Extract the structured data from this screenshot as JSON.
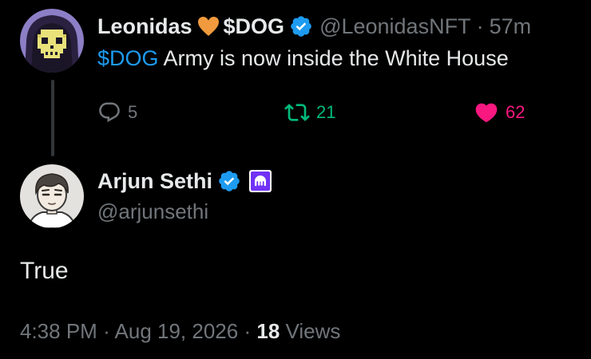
{
  "parent_tweet": {
    "author_name": "Leonidas",
    "heart_emoji_color": "#f19a3e",
    "author_name_suffix": "$DOG",
    "handle": "@LeonidasNFT",
    "separator": "·",
    "time_ago": "57m",
    "text_cashtag": "$DOG",
    "text_rest": " Army is now inside the White House",
    "replies": "5",
    "retweets": "21",
    "likes": "62"
  },
  "reply_tweet": {
    "author_name": "Arjun Sethi",
    "handle": "@arjunsethi",
    "text": "True",
    "time": "4:38 PM",
    "separator_1": "·",
    "date": "Aug 19, 2026",
    "separator_2": "·",
    "views_count": "18",
    "views_label": "Views"
  },
  "colors": {
    "background": "#000000",
    "text_primary": "#e7e9ea",
    "text_secondary": "#71767b",
    "accent_blue": "#1d9bf0",
    "retweet_green": "#00ba7c",
    "like_pink": "#f91880",
    "kraken_purple": "#7132f5"
  },
  "icons": {
    "reply": "speech-bubble-icon",
    "retweet": "retweet-arrows-icon",
    "like": "heart-filled-icon",
    "verified": "verified-badge-icon",
    "affiliate": "kraken-logo-icon"
  }
}
